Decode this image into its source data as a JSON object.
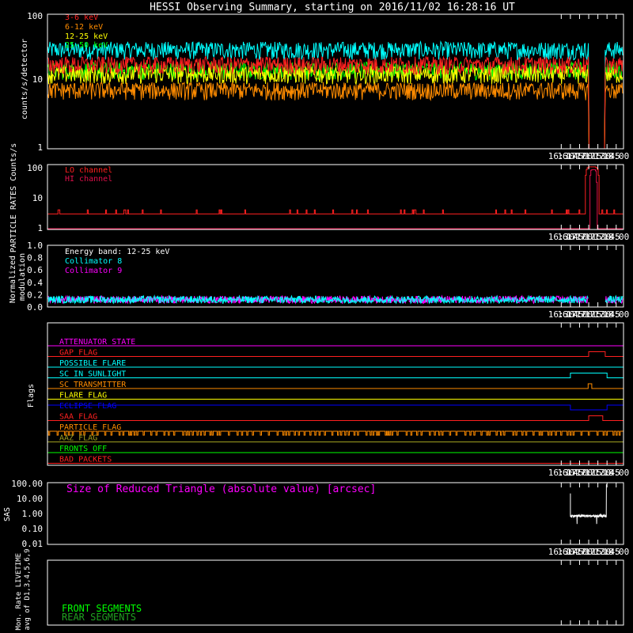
{
  "title": "HESSI Observing Summary, starting on 2016/11/02 16:28:16 UT",
  "time_ticks": [
    "16:30",
    "16:45",
    "17:00",
    "17:15",
    "17:30",
    "17:45",
    "18:00"
  ],
  "time_range_minutes": [
    148.27,
    1092.0
  ],
  "colors": {
    "background": "#000000",
    "axes": "#ffffff",
    "red": "#ff2020",
    "orange": "#ff8c00",
    "yellow": "#ffff00",
    "green": "#00ff00",
    "cyan": "#00ffff",
    "magenta": "#ff00ff",
    "blue": "#0000ff",
    "olive": "#a0a020",
    "crimson": "#e0104a",
    "white": "#ffffff"
  },
  "chart_data": [
    {
      "type": "line",
      "panel": "count-rates",
      "ylabel": "counts/s/detector",
      "yscale": "log",
      "ylim": [
        1,
        100
      ],
      "y_ticks": [
        "1",
        "10",
        "100"
      ],
      "legend_position": "top-left",
      "series": [
        {
          "name": "3-6 keV",
          "color": "#ff2020",
          "level": 18
        },
        {
          "name": "6-12 keV",
          "color": "#ff8c00",
          "level": 7.5
        },
        {
          "name": "12-25 keV",
          "color": "#ffff00",
          "level": 13
        },
        {
          "name": "25-50 keV",
          "color": "#00ff00",
          "level": 15
        },
        {
          "name": "",
          "color": "#00ffff",
          "level": 30
        }
      ],
      "data_gap_minutes": [
        1035,
        1062
      ],
      "x_range_minutes": [
        988,
        1100
      ]
    },
    {
      "type": "line",
      "panel": "particle-rates",
      "ylabel": "PARTICLE RATES Counts/s",
      "yscale": "log",
      "ylim": [
        1,
        100
      ],
      "y_ticks": [
        "1",
        "10",
        "100"
      ],
      "series": [
        {
          "name": "LO channel",
          "color": "#ff2020",
          "baseline": 3,
          "peak": 85
        },
        {
          "name": "HI channel",
          "color": "#e0104a",
          "baseline": 1,
          "peak": 70
        }
      ]
    },
    {
      "type": "line",
      "panel": "modulation",
      "ylabel": "Normalized modulation",
      "ylim": [
        0,
        1
      ],
      "y_ticks": [
        "0.0",
        "0.2",
        "0.4",
        "0.6",
        "0.8",
        "1.0"
      ],
      "annotation": "Energy band: 12-25 keV",
      "series": [
        {
          "name": "Collimator 8",
          "color": "#00ffff",
          "level": 0.12
        },
        {
          "name": "Collimator 9",
          "color": "#ff00ff",
          "level": 0.12
        }
      ]
    },
    {
      "type": "line",
      "panel": "flags",
      "ylabel": "Flags",
      "flags": [
        {
          "name": "ATTENUATOR STATE",
          "color": "#ff00ff",
          "segments": [
            [
              148,
              1092,
              0
            ]
          ]
        },
        {
          "name": "GAP FLAG",
          "color": "#ff2020",
          "segments": [
            [
              148,
              1035,
              0
            ],
            [
              1035,
              1062,
              1
            ],
            [
              1062,
              1092,
              0
            ]
          ]
        },
        {
          "name": "POSSIBLE FLARE",
          "color": "#00ffff",
          "segments": [
            [
              148,
              1092,
              0
            ]
          ]
        },
        {
          "name": "SC IN SUNLIGHT",
          "color": "#00ffff",
          "segments": [
            [
              148,
              1005,
              0
            ],
            [
              1005,
              1065,
              1
            ],
            [
              1065,
              1092,
              0
            ]
          ]
        },
        {
          "name": "SC TRANSMITTER",
          "color": "#ff8c00",
          "segments": [
            [
              148,
              1034,
              0
            ],
            [
              1034,
              1040,
              1
            ],
            [
              1040,
              1092,
              0
            ]
          ]
        },
        {
          "name": "FLARE FLAG",
          "color": "#ffff00",
          "segments": [
            [
              148,
              1092,
              0
            ]
          ]
        },
        {
          "name": "ECLIPSE FLAG",
          "color": "#0000ff",
          "segments": [
            [
              148,
              1005,
              1
            ],
            [
              1005,
              1065,
              0
            ],
            [
              1065,
              1092,
              1
            ]
          ]
        },
        {
          "name": "SAA FLAG",
          "color": "#ff2020",
          "segments": [
            [
              148,
              1035,
              0
            ],
            [
              1035,
              1058,
              1
            ],
            [
              1058,
              1092,
              0
            ]
          ]
        },
        {
          "name": "PARTICLE FLAG",
          "color": "#ff8c00",
          "segments": [
            [
              148,
              1092,
              1
            ]
          ]
        },
        {
          "name": "AAZ FLAG",
          "color": "#a0a020",
          "segments": [
            [
              148,
              1092,
              0
            ]
          ]
        },
        {
          "name": "FRONTS OFF",
          "color": "#00ff00",
          "segments": [
            [
              148,
              1092,
              0
            ]
          ]
        },
        {
          "name": "BAD PACKETS",
          "color": "#ff2020",
          "segments": [
            [
              148,
              1092,
              0
            ]
          ]
        }
      ]
    },
    {
      "type": "line",
      "panel": "sas",
      "ylabel": "SAS",
      "yscale": "log",
      "ylim": [
        0.01,
        100
      ],
      "y_ticks": [
        "0.01",
        "0.10",
        "1.00",
        "10.00",
        "100.00"
      ],
      "annotation": "Size of Reduced Triangle (absolute value) [arcsec]",
      "series": [
        {
          "name": "",
          "color": "#ffffff",
          "start_min": 1005,
          "end_min": 1064,
          "level": 0.7
        }
      ]
    },
    {
      "type": "line",
      "panel": "livetime",
      "ylabel": "Mon. Rate LIVETIME avg of D1,3,4,5,6,9",
      "legend_position": "bottom-left",
      "series": [
        {
          "name": "FRONT SEGMENTS",
          "color": "#00ff00"
        },
        {
          "name": "REAR SEGMENTS",
          "color": "#20a020"
        }
      ]
    }
  ]
}
